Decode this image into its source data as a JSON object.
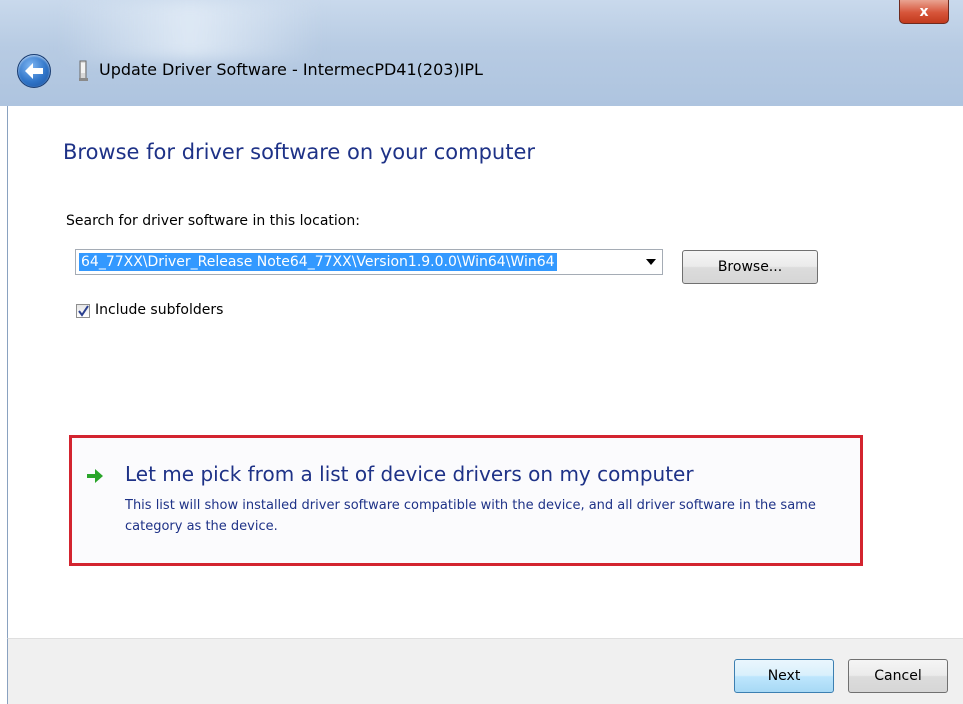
{
  "window": {
    "title": "Update Driver Software - IntermecPD41(203)IPL",
    "close_label": "x"
  },
  "page": {
    "heading": "Browse for driver software on your computer",
    "search_label": "Search for driver software in this location:",
    "path_value": "64_77XX\\Driver_Release Note64_77XX\\Version1.9.0.0\\Win64\\Win64",
    "browse_label": "Browse...",
    "include_subfolders": {
      "label": "Include subfolders",
      "checked": true
    },
    "pick_option": {
      "title": "Let me pick from a list of device drivers on my computer",
      "description": "This list will show installed driver software compatible with the device, and all driver software in the same category as the device.",
      "highlight_color": "#d3242f",
      "arrow_color": "#2aa52a"
    }
  },
  "footer": {
    "next_label": "Next",
    "cancel_label": "Cancel"
  },
  "icons": {
    "back": "back-arrow-icon",
    "device": "device-icon",
    "option_arrow": "green-arrow-icon",
    "combo": "chevron-down-icon",
    "check": "checkmark-icon"
  }
}
